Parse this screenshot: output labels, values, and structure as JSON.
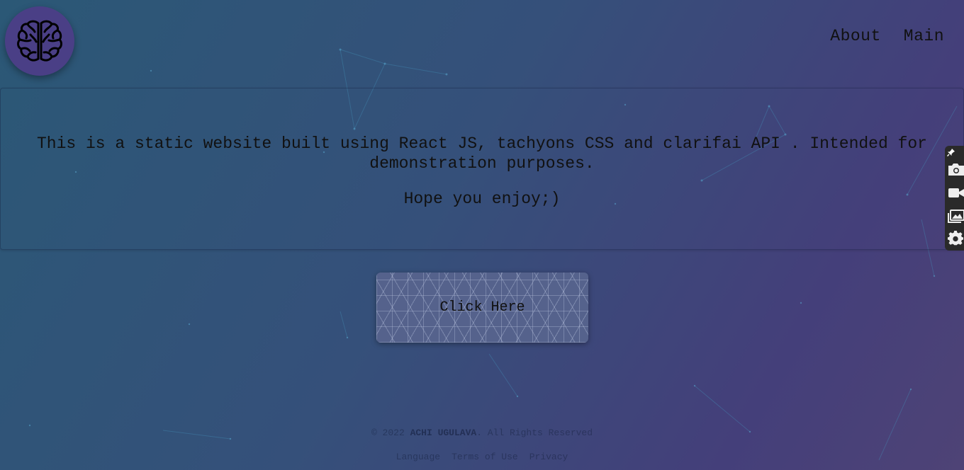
{
  "nav": {
    "about": "About",
    "main": "Main"
  },
  "intro": {
    "description": "This is a static website built using React JS, tachyons CSS and clarifai API . Intended for demonstration purposes.",
    "greeting": "Hope you enjoy;)"
  },
  "cta": {
    "label": "Click Here"
  },
  "footer": {
    "copyright_prefix": "© 2022",
    "author": "ACHI UGULAVA",
    "copyright_suffix": ". All Rights Reserved",
    "links": [
      "Language",
      "Terms of Use",
      "Privacy"
    ]
  },
  "icons": {
    "logo": "brain-icon",
    "toolbar": [
      "pin-icon",
      "camera-icon",
      "video-icon",
      "gallery-icon",
      "gear-icon"
    ]
  },
  "colors": {
    "gradient_start": "#2b5876",
    "gradient_end": "#4e4376",
    "logo_bg": "#4a3f86",
    "text": "#111111"
  }
}
